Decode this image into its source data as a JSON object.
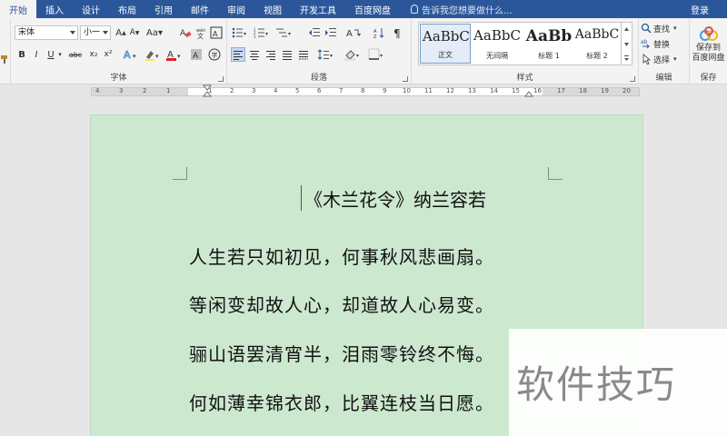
{
  "tabs": [
    "开始",
    "插入",
    "设计",
    "布局",
    "引用",
    "邮件",
    "审阅",
    "视图",
    "开发工具",
    "百度网盘"
  ],
  "tell_me": "告诉我您想要做什么...",
  "login": "登录",
  "font": {
    "name": "宋体",
    "size": "小一",
    "group_label": "字体",
    "format_buttons": [
      "B",
      "I",
      "U",
      "abc",
      "x₂",
      "x²"
    ]
  },
  "paragraph": {
    "group_label": "段落"
  },
  "styles": {
    "group_label": "样式",
    "items": [
      {
        "preview": "AaBbC",
        "name": "正文"
      },
      {
        "preview": "AaBbC",
        "name": "无间隔"
      },
      {
        "preview": "AaBb",
        "name": "标题 1"
      },
      {
        "preview": "AaBbC",
        "name": "标题 2"
      }
    ]
  },
  "editing": {
    "group_label": "编辑",
    "find": "查找",
    "replace": "替换",
    "select": "选择"
  },
  "save": {
    "group_label": "保存",
    "label_line1": "保存到",
    "label_line2": "百度网盘"
  },
  "ruler_numbers": [
    "4",
    "3",
    "2",
    "1",
    "1",
    "2",
    "3",
    "4",
    "5",
    "6",
    "7",
    "8",
    "9",
    "10",
    "11",
    "12",
    "13",
    "14",
    "15",
    "16",
    "17",
    "18",
    "19",
    "20"
  ],
  "document": {
    "title": "《木兰花令》纳兰容若",
    "lines": [
      "人生若只如初见，何事秋风悲画扇。",
      "等闲变却故人心，却道故人心易变。",
      "骊山语罢清宵半，泪雨零铃终不悔。",
      "何如薄幸锦衣郎，比翼连枝当日愿。"
    ]
  },
  "watermark": "软件技巧"
}
